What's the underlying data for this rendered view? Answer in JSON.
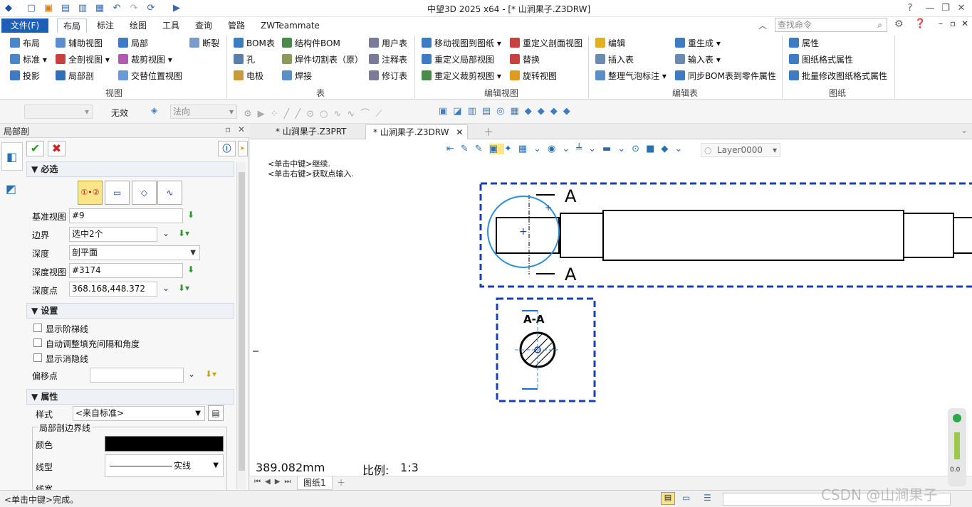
{
  "app": {
    "title": "中望3D 2025 x64 - [* 山涧果子.Z3DRW]"
  },
  "menu_tabs": [
    "文件(F)",
    "布局",
    "标注",
    "绘图",
    "工具",
    "查询",
    "管路",
    "ZWTeammate"
  ],
  "active_tab": "布局",
  "search": {
    "placeholder": "查找命令"
  },
  "ribbon": {
    "view": {
      "group": "视图",
      "items": [
        "布局",
        "辅助视图",
        "局部",
        "断裂",
        "标准",
        "全剖视图",
        "裁剪视图",
        "投影",
        "局部剖",
        "交替位置视图"
      ]
    },
    "table": {
      "group": "表",
      "items": [
        "BOM表",
        "结构件BOM",
        "用户表",
        "孔",
        "焊件切割表（原）",
        "注释表",
        "电极",
        "焊接",
        "修订表"
      ]
    },
    "editview": {
      "group": "编辑视图",
      "items": [
        "移动视图到图纸",
        "重定义剖面视图",
        "重定义局部视图",
        "替换",
        "重定义裁剪视图",
        "旋转视图"
      ]
    },
    "edittable": {
      "group": "编辑表",
      "items": [
        "编辑",
        "重生成",
        "插入表",
        "输入表",
        "整理气泡标注",
        "同步BOM表到零件属性"
      ]
    },
    "drawing": {
      "group": "图纸",
      "items": [
        "属性",
        "图纸格式属性",
        "批量修改图纸格式属性"
      ]
    }
  },
  "cmdbar": {
    "filter": "",
    "invalid": "无效",
    "direction": "法向"
  },
  "panel": {
    "title": "局部剖",
    "required": "必选",
    "base_view_label": "基准视图",
    "base_view": "#9",
    "boundary_label": "边界",
    "boundary": "选中2个",
    "depth_label": "深度",
    "depth": "剖平面",
    "depth_view_label": "深度视图",
    "depth_view": "#3174",
    "depth_point_label": "深度点",
    "depth_point": "368.168,448.372",
    "settings": "设置",
    "opt1": "显示阶梯线",
    "opt2": "自动调整填充间隔和角度",
    "opt3": "显示消隐线",
    "offset_label": "偏移点",
    "offset": "",
    "properties": "属性",
    "style_label": "样式",
    "style": "<来自标准>",
    "boundary_group": "局部剖边界线",
    "color_label": "颜色",
    "linetype_label": "线型",
    "linetype": "实线",
    "linewidth_label": "线宽"
  },
  "doc_tabs": [
    "* 山涧果子.Z3PRT",
    "* 山涧果子.Z3DRW"
  ],
  "canvas": {
    "hint1": "<单击中键>继续.",
    "hint2": "<单击右键>获取点输入.",
    "layer": "Layer0000",
    "section_a": "A",
    "section_aa": "A-A",
    "length": "389.082mm",
    "scale_label": "比例:",
    "scale": "1:3",
    "sheet": "图纸1"
  },
  "status": {
    "text": "<单击中键>完成。"
  },
  "slider": {
    "value": "0.0"
  },
  "watermark": "CSDN @山涧果子",
  "colors": {
    "accent": "#1c5fb7",
    "sel": "#1a3fb5",
    "circle": "#2e8fd8"
  }
}
